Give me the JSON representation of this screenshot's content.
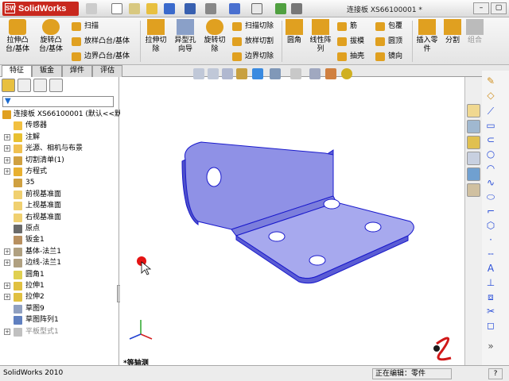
{
  "app": {
    "logo": "SolidWorks",
    "title": "连接板 XS66100001 *",
    "minimize": "–",
    "maximize": "▢"
  },
  "ribbon": {
    "big": [
      {
        "label": "拉伸凸\n台/基体",
        "color": "#e0a020"
      },
      {
        "label": "旋转凸\n台/基体",
        "color": "#e0a020"
      },
      {
        "label": "拉伸切\n除",
        "color": "#e0a020"
      },
      {
        "label": "异型孔\n向导",
        "color": "#8aa0c8"
      },
      {
        "label": "旋转切\n除",
        "color": "#e0a020"
      },
      {
        "label": "圆角",
        "color": "#e0a020"
      },
      {
        "label": "线性阵\n列",
        "color": "#e0a020"
      },
      {
        "label": "插入零\n件",
        "color": "#e0a020"
      },
      {
        "label": "分割",
        "color": "#e0a020"
      },
      {
        "label": "组合",
        "color": "#bbbbbb"
      }
    ],
    "small": [
      {
        "label": "扫描",
        "color": "#e0a020"
      },
      {
        "label": "放样凸台/基体",
        "color": "#e0a020"
      },
      {
        "label": "边界凸台/基体",
        "color": "#e0a020"
      },
      {
        "label": "扫描切除",
        "color": "#e0a020"
      },
      {
        "label": "放样切割",
        "color": "#e0a020"
      },
      {
        "label": "边界切除",
        "color": "#e0a020"
      },
      {
        "label": "筋",
        "color": "#e0a020"
      },
      {
        "label": "拔模",
        "color": "#e0a020"
      },
      {
        "label": "抽壳",
        "color": "#e0a020"
      },
      {
        "label": "包覆",
        "color": "#e0a020"
      },
      {
        "label": "圆顶",
        "color": "#e0a020"
      },
      {
        "label": "镜向",
        "color": "#e0a020"
      }
    ]
  },
  "tabs": [
    "特征",
    "钣金",
    "焊件",
    "评估"
  ],
  "tree": [
    {
      "label": "连接板 XS66100001 (默认<<默",
      "exp": "",
      "icon": "#e0a020"
    },
    {
      "label": "传感器",
      "exp": "",
      "icon": "#f2c040"
    },
    {
      "label": "注解",
      "exp": "+",
      "icon": "#e8c030"
    },
    {
      "label": "光源、相机与布景",
      "exp": "+",
      "icon": "#f0c050"
    },
    {
      "label": "切割清单(1)",
      "exp": "+",
      "icon": "#d0a040"
    },
    {
      "label": "方程式",
      "exp": "+",
      "icon": "#e8b030"
    },
    {
      "label": "35",
      "exp": "",
      "icon": "#cfa040"
    },
    {
      "label": "前视基准面",
      "exp": "",
      "icon": "#f0d070"
    },
    {
      "label": "上视基准面",
      "exp": "",
      "icon": "#f0d070"
    },
    {
      "label": "右视基准面",
      "exp": "",
      "icon": "#f0d070"
    },
    {
      "label": "原点",
      "exp": "",
      "icon": "#6a6a6a"
    },
    {
      "label": "钣金1",
      "exp": "",
      "icon": "#b89060"
    },
    {
      "label": "基体-法兰1",
      "exp": "+",
      "icon": "#b0a080"
    },
    {
      "label": "边线-法兰1",
      "exp": "+",
      "icon": "#b0a080"
    },
    {
      "label": "圆角1",
      "exp": "",
      "icon": "#e0d050"
    },
    {
      "label": "拉伸1",
      "exp": "+",
      "icon": "#e0c040"
    },
    {
      "label": "拉伸2",
      "exp": "+",
      "icon": "#e0c040"
    },
    {
      "label": "草图9",
      "exp": "",
      "icon": "#90a0c0"
    },
    {
      "label": "草图阵列1",
      "exp": "",
      "icon": "#6080c0"
    },
    {
      "label": "平板型式1",
      "exp": "+",
      "icon": "#c0c0c0"
    }
  ],
  "viewport": {
    "view_name": "*等轴测"
  },
  "colors": {
    "part_fill": "#a7a9ee",
    "part_edge": "#1a1acc",
    "origin_dot": "#e41313"
  },
  "status": {
    "left": "SolidWorks 2010",
    "right": "正在编辑：零件",
    "help": "?"
  }
}
